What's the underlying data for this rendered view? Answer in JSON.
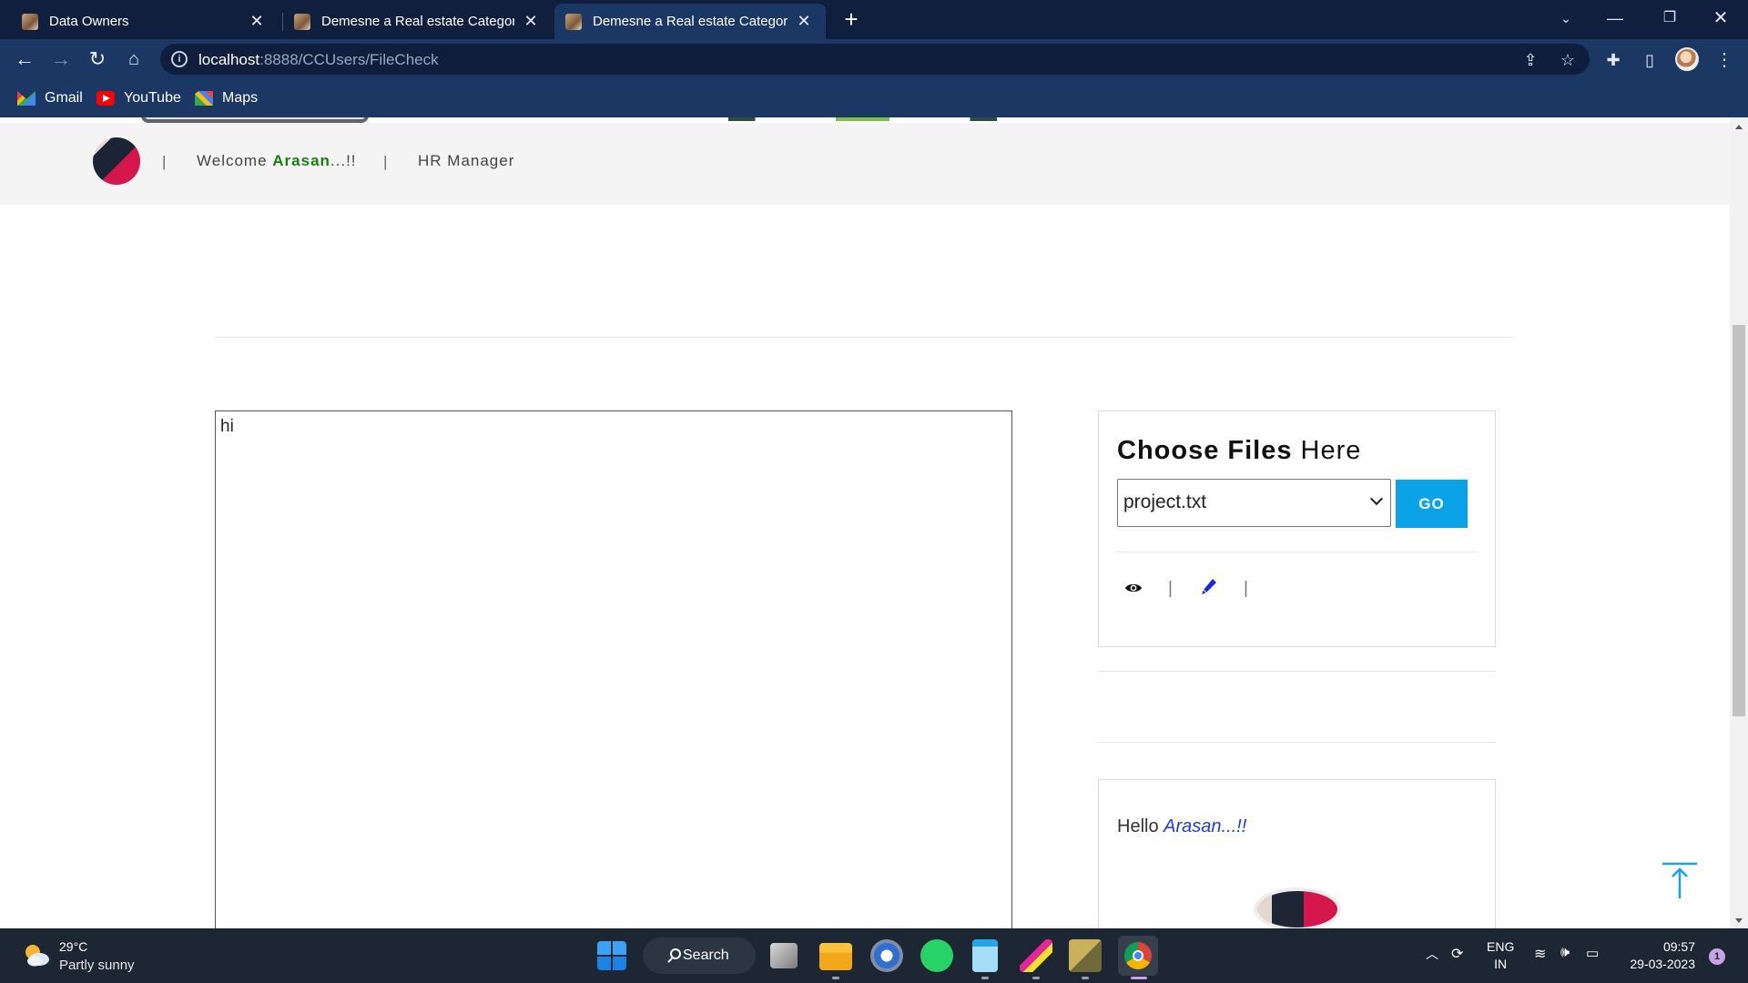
{
  "browser": {
    "tabs": [
      {
        "title": "Data Owners",
        "active": false
      },
      {
        "title": "Demesne a Real estate Category",
        "active": false
      },
      {
        "title": "Demesne a Real estate Category",
        "active": true
      }
    ],
    "address": {
      "host": "localhost",
      "path": ":8888/CCUsers/FileCheck"
    },
    "bookmarks": [
      {
        "label": "Gmail",
        "icon": "gmail-icon"
      },
      {
        "label": "YouTube",
        "icon": "youtube-icon"
      },
      {
        "label": "Maps",
        "icon": "maps-icon"
      }
    ]
  },
  "header": {
    "separator": "|",
    "welcome_prefix": "Welcome ",
    "user_name": "Arasan",
    "welcome_suffix": "...!!",
    "role": "HR Manager"
  },
  "file_view": {
    "content": "hi"
  },
  "choose_panel": {
    "title_bold": "Choose Files",
    "title_rest": " Here",
    "selected_file": "project.txt",
    "go_label": "GO",
    "separator": "|"
  },
  "hello_panel": {
    "greeting": "Hello ",
    "name": "Arasan...!!"
  },
  "taskbar": {
    "weather_temp": "29°C",
    "weather_desc": "Partly sunny",
    "search_label": "Search",
    "lang_line1": "ENG",
    "lang_line2": "IN",
    "time": "09:57",
    "date": "29-03-2023",
    "notification_count": "1"
  },
  "colors": {
    "chrome_dark": "#0f1f3d",
    "chrome_toolbar": "#1b3763",
    "user_name_green": "#1a7f10",
    "go_button": "#0aa3e8",
    "hello_name_blue": "#1e3be6"
  }
}
